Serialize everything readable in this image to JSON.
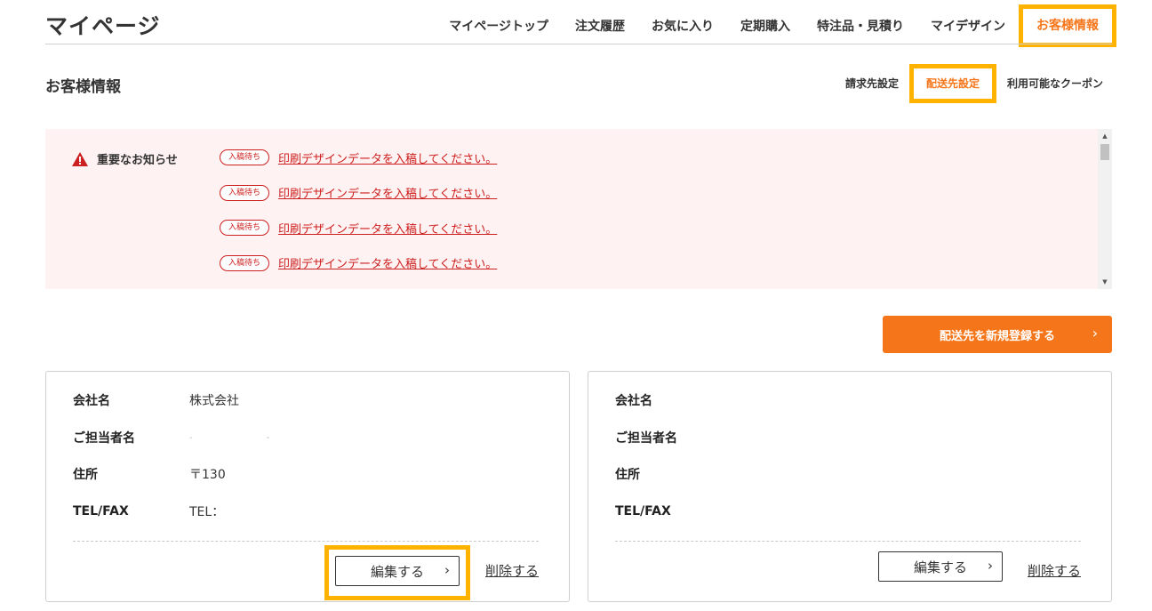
{
  "header": {
    "title": "マイページ",
    "nav": [
      {
        "label": "マイページトップ",
        "active": false
      },
      {
        "label": "注文履歴",
        "active": false
      },
      {
        "label": "お気に入り",
        "active": false
      },
      {
        "label": "定期購入",
        "active": false
      },
      {
        "label": "特注品・見積り",
        "active": false
      },
      {
        "label": "マイデザイン",
        "active": false
      },
      {
        "label": "お客様情報",
        "active": true
      }
    ]
  },
  "section": {
    "title": "お客様情報",
    "subnav": [
      {
        "label": "請求先設定",
        "active": false
      },
      {
        "label": "配送先設定",
        "active": true
      },
      {
        "label": "利用可能なクーポン",
        "active": false
      }
    ]
  },
  "notice": {
    "label": "重要なお知らせ",
    "items": [
      {
        "badge": "入稿待ち",
        "text": "印刷デザインデータを入稿してください。"
      },
      {
        "badge": "入稿待ち",
        "text": "印刷デザインデータを入稿してください。"
      },
      {
        "badge": "入稿待ち",
        "text": "印刷デザインデータを入稿してください。"
      },
      {
        "badge": "入稿待ち",
        "text": "印刷デザインデータを入稿してください。"
      }
    ]
  },
  "actions": {
    "register_label": "配送先を新規登録する",
    "chevron": "›"
  },
  "cards": [
    {
      "fields": [
        {
          "label": "会社名",
          "value": "株式会社"
        },
        {
          "label": "ご担当者名",
          "value": "- -"
        },
        {
          "label": "住所",
          "value": "〒130"
        },
        {
          "label": "TEL/FAX",
          "value": "TEL："
        }
      ],
      "edit_label": "編集する",
      "delete_label": "削除する"
    },
    {
      "fields": [
        {
          "label": "会社名",
          "value": ""
        },
        {
          "label": "ご担当者名",
          "value": ""
        },
        {
          "label": "住所",
          "value": ""
        },
        {
          "label": "TEL/FAX",
          "value": ""
        }
      ],
      "edit_label": "編集する",
      "delete_label": "削除する"
    }
  ],
  "colors": {
    "accent": "#f5761a",
    "highlight": "#ffb300",
    "alert": "#cc1f1f",
    "notice_bg": "#fff2f2"
  },
  "icons": {
    "warning": "warning-triangle-icon",
    "chevron": "chevron-right-icon",
    "scroll_up": "scroll-up-arrow-icon",
    "scroll_down": "scroll-down-arrow-icon"
  }
}
